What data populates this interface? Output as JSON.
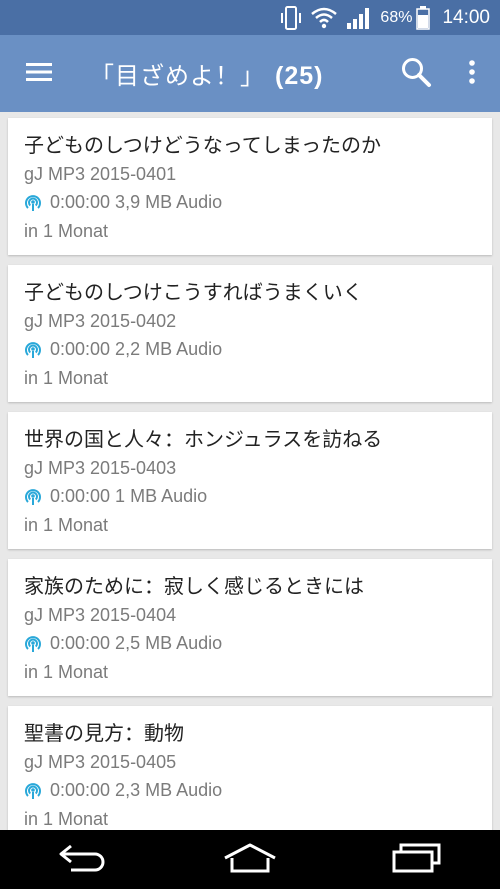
{
  "status_bar": {
    "battery_pct": "68%",
    "time": "14:00",
    "icons": [
      "vibrate-icon",
      "wifi-icon",
      "signal-icon",
      "battery-icon"
    ]
  },
  "app_bar": {
    "title": "「目ざめよ！」",
    "count": "(25)",
    "icons": [
      "menu-icon",
      "search-icon",
      "more-vert-icon"
    ]
  },
  "episodes": [
    {
      "title": "子どものしつけどうなってしまったのか",
      "subtitle": "gJ MP3 2015-0401",
      "meta": "0:00:00 3,9 MB Audio",
      "date": "in 1 Monat"
    },
    {
      "title": "子どものしつけこうすればうまくいく",
      "subtitle": "gJ MP3 2015-0402",
      "meta": "0:00:00 2,2 MB Audio",
      "date": "in 1 Monat"
    },
    {
      "title": "世界の国と人々：ホンジュラスを訪ねる",
      "subtitle": "gJ MP3 2015-0403",
      "meta": "0:00:00 1 MB Audio",
      "date": "in 1 Monat"
    },
    {
      "title": "家族のために：寂しく感じるときには",
      "subtitle": "gJ MP3 2015-0404",
      "meta": "0:00:00 2,5 MB Audio",
      "date": "in 1 Monat"
    },
    {
      "title": "聖書の見方：動物",
      "subtitle": "gJ MP3 2015-0405",
      "meta": "0:00:00 2,3 MB Audio",
      "date": "in 1 Monat"
    }
  ],
  "colors": {
    "status_bar": "#4a6fa5",
    "app_bar": "#6a90c4",
    "podcast_icon": "#29a8d9",
    "background": "#e8e8e8"
  },
  "nav_bar": {
    "icons": [
      "back-icon",
      "home-icon",
      "recents-icon"
    ]
  }
}
